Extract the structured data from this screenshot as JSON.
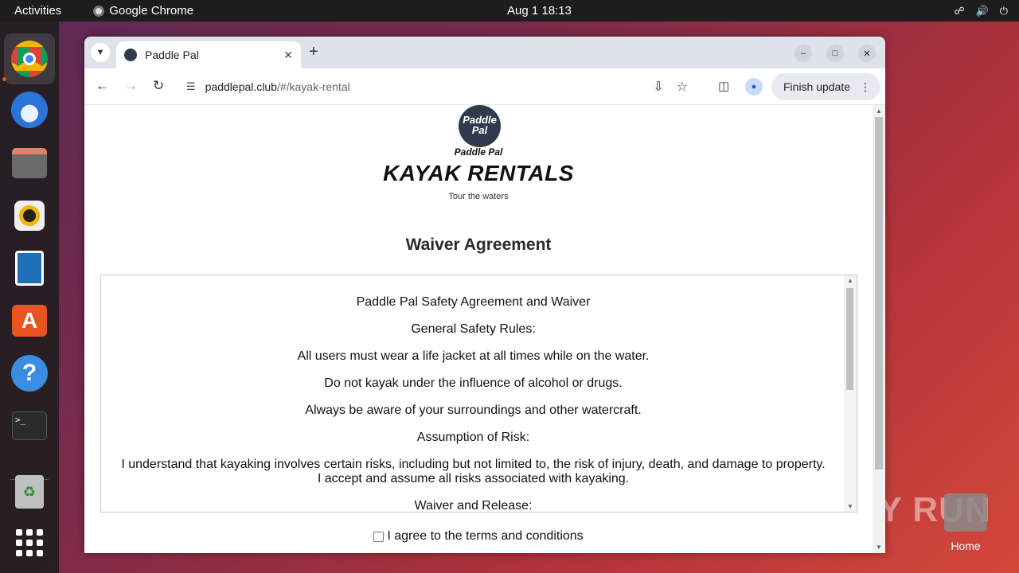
{
  "topbar": {
    "activities": "Activities",
    "app_name": "Google Chrome",
    "clock": "Aug 1  18:13",
    "tray_icons": [
      "network-icon",
      "volume-icon",
      "power-icon"
    ]
  },
  "dock": {
    "items": [
      "chrome",
      "thunderbird",
      "files",
      "rhythmbox",
      "libreoffice-writer",
      "app-center",
      "help",
      "terminal",
      "trash",
      "show-apps"
    ]
  },
  "browser": {
    "tab_title": "Paddle Pal",
    "new_tab": "+",
    "url_host": "paddlepal.club",
    "url_path": "/#/kayak-rental",
    "finish_update": "Finish update"
  },
  "page": {
    "logo_text": "Paddle Pal",
    "logo_line1": "Paddle",
    "logo_line2": "Pal",
    "brand_title": "KAYAK RENTALS",
    "tagline": "Tour the waters",
    "section_title": "Waiver Agreement",
    "waiver_paragraphs": [
      "Paddle Pal Safety Agreement and Waiver",
      "General Safety Rules:",
      "All users must wear a life jacket at all times while on the water.",
      "Do not kayak under the influence of alcohol or drugs.",
      "Always be aware of your surroundings and other watercraft.",
      "Assumption of Risk:",
      "I understand that kayaking involves certain risks, including but not limited to, the risk of injury, death, and damage to property.",
      "I accept and assume all risks associated with kayaking.",
      "Waiver and Release:"
    ],
    "agree_label": "I agree to the terms and conditions",
    "agree_checked": false
  },
  "desktop": {
    "home_label": "Home",
    "watermark": "ANY RUN"
  },
  "colors": {
    "topbar": "#1d1d1d",
    "tabstrip": "#dee3ea",
    "accent": "#e95420",
    "logo": "#2f3b4a"
  }
}
